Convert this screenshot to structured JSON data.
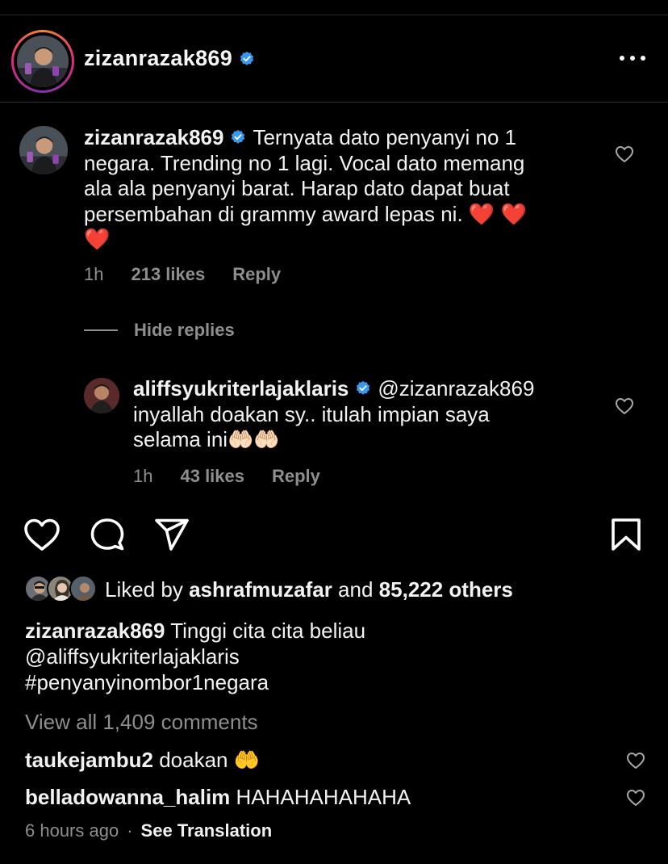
{
  "header": {
    "username": "zizanrazak869",
    "verified": true
  },
  "main_comment": {
    "username": "zizanrazak869",
    "text_line1": "Ternyata dato penyanyi no 1",
    "text_line2": "negara. Trending no 1 lagi. Vocal dato memang",
    "text_line3": "ala ala penyanyi barat. Harap dato dapat buat",
    "text_line4": "persembahan di grammy award lepas ni. ❤️ ❤️",
    "text_line5": "❤️",
    "time": "1h",
    "likes": "213 likes",
    "reply_label": "Reply"
  },
  "hide_replies_label": "Hide replies",
  "reply_comment": {
    "username": "aliffsyukriterlajaklaris",
    "mention": "@zizanrazak869",
    "text_line2": "inyallah doakan sy.. itulah impian saya",
    "text_line3": "selama ini🤲🏻🤲🏻",
    "time": "1h",
    "likes": "43 likes",
    "reply_label": "Reply"
  },
  "likes": {
    "prefix": "Liked by",
    "user": "ashrafmuzafar",
    "and": "and",
    "count": "85,222 others"
  },
  "caption": {
    "username": "zizanrazak869",
    "text": "Tinggi cita cita beliau",
    "mention": "@aliffsyukriterlajaklaris",
    "hashtag": "#penyanyinombor1negara"
  },
  "view_all": "View all 1,409 comments",
  "comments": [
    {
      "username": "taukejambu2",
      "text": "doakan 🤲"
    },
    {
      "username": "belladowanna_halim",
      "text": "HAHAHAHAHAHA"
    }
  ],
  "footer": {
    "time": "6 hours ago",
    "separator": "·",
    "see_translation": "See Translation"
  },
  "colors": {
    "background": "#000000",
    "text": "#f2f2f2",
    "muted": "#8e8e8e",
    "verified": "#3897f0"
  }
}
